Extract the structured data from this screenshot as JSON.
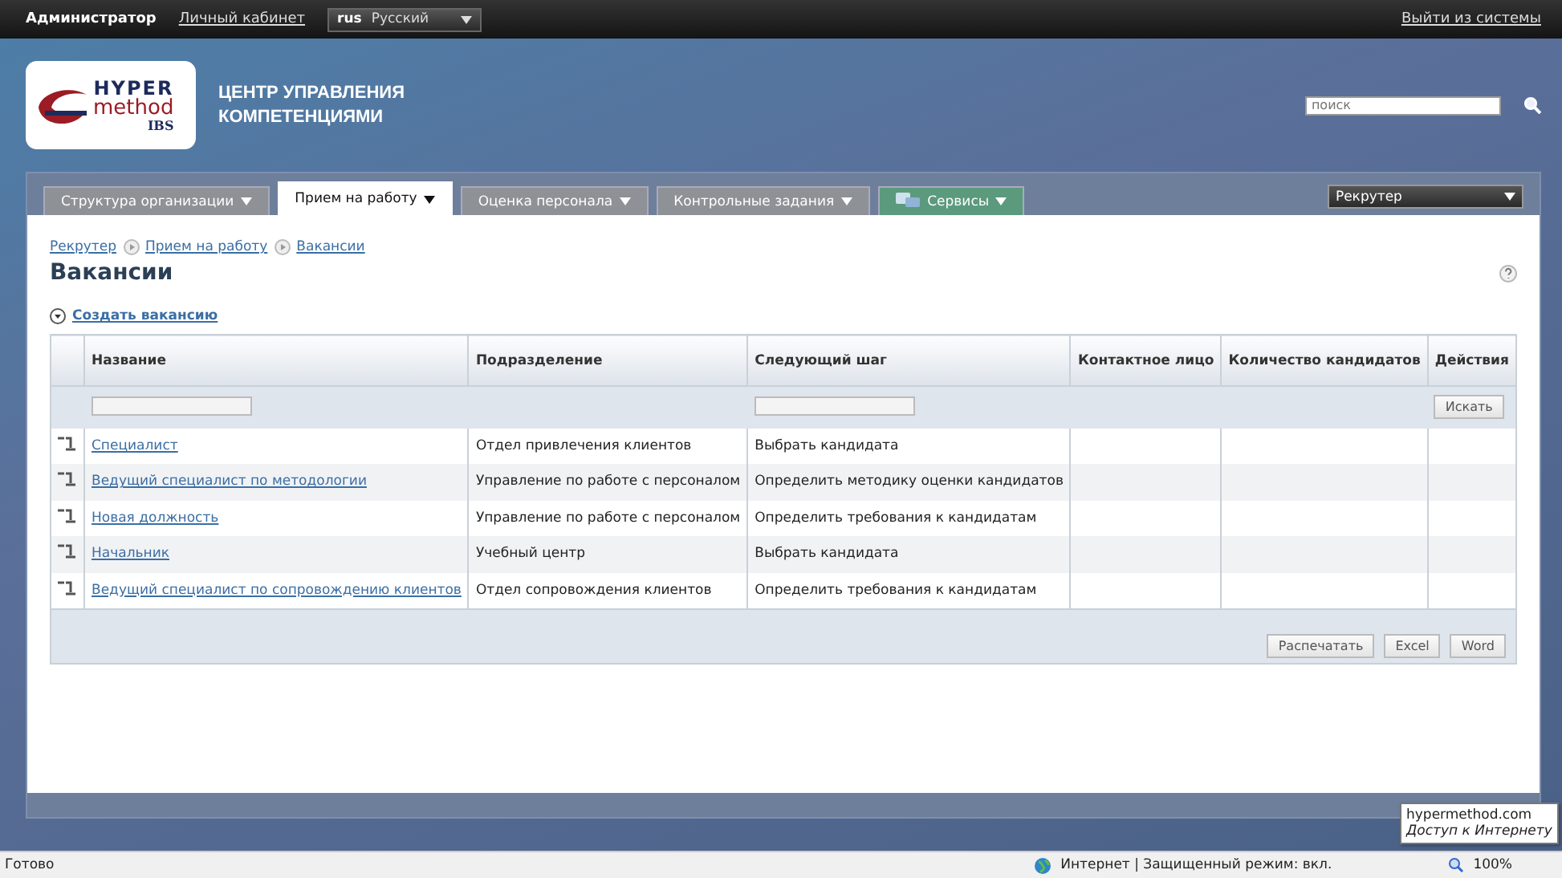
{
  "top_bar": {
    "user": "Администратор",
    "cabinet_link": "Личный кабинет",
    "language": {
      "code": "rus",
      "name": "Русский"
    },
    "logout_link": "Выйти из системы"
  },
  "header": {
    "logo": {
      "line_1": "HYPER",
      "line_2": "method",
      "line_3": "IBS"
    },
    "title_lines": [
      "ЦЕНТР УПРАВЛЕНИЯ",
      "КОМПЕТЕНЦИЯМИ"
    ],
    "search": {
      "placeholder": "поиск"
    }
  },
  "tabs": [
    {
      "label": "Структура организации",
      "kind": "menu",
      "selected": false
    },
    {
      "label": "Прием на работу",
      "kind": "menu",
      "selected": true
    },
    {
      "label": "Оценка персонала",
      "kind": "menu",
      "selected": false
    },
    {
      "label": "Контрольные задания",
      "kind": "menu",
      "selected": false
    },
    {
      "label": "Сервисы",
      "kind": "services",
      "selected": false
    }
  ],
  "role_select": {
    "value": "Рекрутер"
  },
  "breadcrumbs": [
    "Рекрутер",
    "Прием на работу",
    "Вакансии"
  ],
  "page_title": "Вакансии",
  "create_link": "Создать вакансию",
  "table": {
    "columns": [
      {
        "label": "Название",
        "filter": true
      },
      {
        "label": "Подразделение",
        "filter": false
      },
      {
        "label": "Следующий шаг",
        "filter": true
      },
      {
        "label": "Контактное лицо",
        "filter": false
      },
      {
        "label": "Количество кандидатов",
        "filter": false
      },
      {
        "label": "Действия",
        "filter": false
      }
    ],
    "search_button": "Искать",
    "rows": [
      {
        "name": "Специалист",
        "department": "Отдел привлечения клиентов",
        "next_step": "Выбрать кандидата"
      },
      {
        "name": "Ведущий специалист по методологии",
        "department": "Управление по работе с персоналом",
        "next_step": "Определить методику оценки кандидатов"
      },
      {
        "name": "Новая должность",
        "department": "Управление по работе с персоналом",
        "next_step": "Определить требования к кандидатам"
      },
      {
        "name": "Начальник",
        "department": "Учебный центр",
        "next_step": "Выбрать кандидата"
      },
      {
        "name": "Ведущий специалист по сопровождению клиентов",
        "department": "Отдел сопровождения клиентов",
        "next_step": "Определить требования к кандидатам"
      }
    ],
    "export_buttons": [
      "Распечатать",
      "Excel",
      "Word"
    ]
  },
  "tooltip": {
    "title": "hypermethod.com",
    "subtitle": "Доступ к Интернету"
  },
  "status_bar": {
    "left": "Готово",
    "zone": "Интернет | Защищенный режим: вкл.",
    "zoom": "100%"
  }
}
